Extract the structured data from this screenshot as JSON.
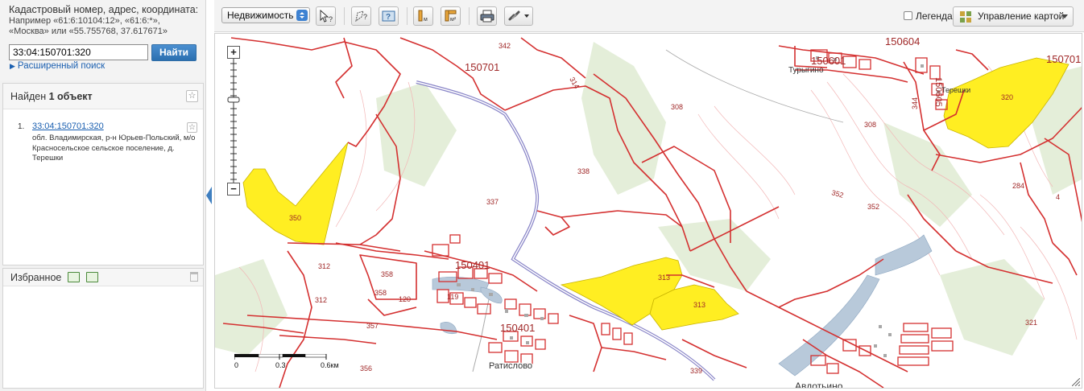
{
  "search": {
    "title": "Кадастровый номер, адрес, координата:",
    "hint": "Например «61:6:10104:12», «61:6:*», «Москва» или «55.755768, 37.617671»",
    "value": "33:04:150701:320",
    "button": "Найти",
    "advanced": "Расширенный поиск"
  },
  "results": {
    "header_prefix": "Найден ",
    "header_count": "1 объект",
    "items": [
      {
        "num": "1.",
        "cadastral": "33:04:150701:320",
        "address": "обл. Владимирская, р-н Юрьев-Польский, м/о Красносельское сельское поселение, д. Терешки"
      }
    ]
  },
  "favorites": {
    "title": "Избранное"
  },
  "toolbar": {
    "select_value": "Недвижимость",
    "legend_label": "Легенда",
    "map_control_label": "Управление картой"
  },
  "map": {
    "blocks": [
      "150701",
      "150601",
      "150604",
      "150701",
      "150401",
      "150401",
      "150605"
    ],
    "parcel_labels": [
      "342",
      "314",
      "308",
      "344",
      "308",
      "320",
      "338",
      "337",
      "350",
      "352",
      "352",
      "284",
      "4",
      "312",
      "358",
      "358",
      "120",
      "119",
      "312",
      "357",
      "313",
      "313",
      "321",
      "339",
      "356"
    ],
    "places": [
      "Турыгино",
      "Терешки",
      "Ратислово",
      "Авдотьино"
    ],
    "scale": [
      "0",
      "0.3",
      "0.6км"
    ]
  },
  "colors": {
    "boundary": "#d43030",
    "highlight": "#ffee22",
    "road": "#8a86c8",
    "relief": "#f0a8a8",
    "water": "#b5c8da",
    "forest": "#e2ecd6"
  }
}
